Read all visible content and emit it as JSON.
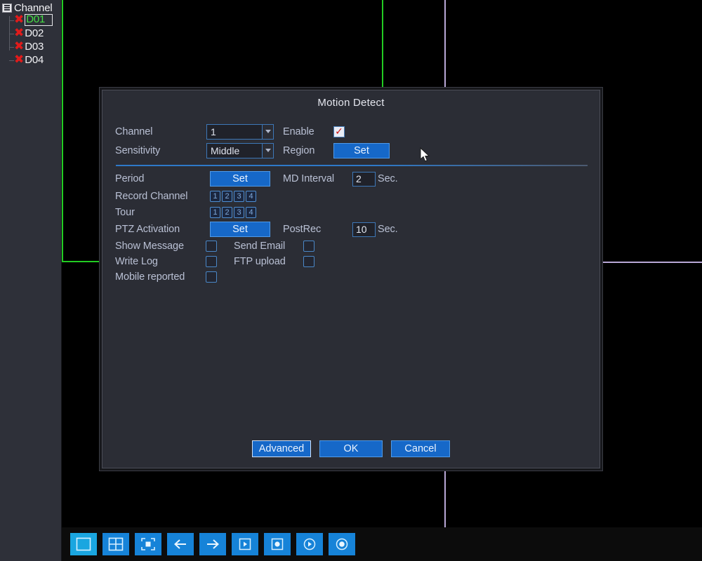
{
  "sidebar": {
    "title": "Channel",
    "tree_icon": "list-icon",
    "channels": [
      {
        "label": "D01",
        "status_icon": "x-icon",
        "selected": true
      },
      {
        "label": "D02",
        "status_icon": "x-icon",
        "selected": false
      },
      {
        "label": "D03",
        "status_icon": "x-icon",
        "selected": false
      },
      {
        "label": "D04",
        "status_icon": "x-icon",
        "selected": false
      }
    ]
  },
  "video_wall": {
    "layout": "2x2",
    "active_pane_border_color": "#22cc22",
    "divider_color": "#b9a8d6",
    "background_color": "#000000"
  },
  "dialog": {
    "title": "Motion Detect",
    "channel": {
      "label": "Channel",
      "value": "1"
    },
    "enable": {
      "label": "Enable",
      "checked": true
    },
    "sensitivity": {
      "label": "Sensitivity",
      "value": "Middle"
    },
    "region": {
      "label": "Region",
      "button": "Set"
    },
    "period": {
      "label": "Period",
      "button": "Set"
    },
    "md_interval": {
      "label": "MD Interval",
      "value": "2",
      "unit": "Sec."
    },
    "record_channel": {
      "label": "Record Channel",
      "options": [
        "1",
        "2",
        "3",
        "4"
      ]
    },
    "tour": {
      "label": "Tour",
      "options": [
        "1",
        "2",
        "3",
        "4"
      ]
    },
    "ptz_activation": {
      "label": "PTZ Activation",
      "button": "Set"
    },
    "post_rec": {
      "label": "PostRec",
      "value": "10",
      "unit": "Sec."
    },
    "show_message": {
      "label": "Show Message",
      "checked": false
    },
    "send_email": {
      "label": "Send Email",
      "checked": false
    },
    "write_log": {
      "label": "Write Log",
      "checked": false
    },
    "ftp_upload": {
      "label": "FTP upload",
      "checked": false
    },
    "mobile_reported": {
      "label": "Mobile reported",
      "checked": false
    },
    "buttons": {
      "advanced": "Advanced",
      "ok": "OK",
      "cancel": "Cancel"
    }
  },
  "toolbar": {
    "items": [
      {
        "icon": "single-view-icon",
        "active": true
      },
      {
        "icon": "quad-view-icon",
        "active": false
      },
      {
        "icon": "zoom-view-icon",
        "active": false
      },
      {
        "icon": "arrow-left-icon",
        "active": false
      },
      {
        "icon": "arrow-right-icon",
        "active": false
      },
      {
        "icon": "play-square-icon",
        "active": false
      },
      {
        "icon": "record-square-icon",
        "active": false
      },
      {
        "icon": "play-circle-icon",
        "active": false
      },
      {
        "icon": "record-circle-icon",
        "active": false
      }
    ]
  },
  "colors": {
    "accent_blue": "#1668c8",
    "toolbar_blue": "#1683d8",
    "active_green": "#44e044",
    "alert_red": "#e01b1b",
    "panel_bg": "#2b2d35",
    "sidebar_bg": "#2e3039"
  }
}
